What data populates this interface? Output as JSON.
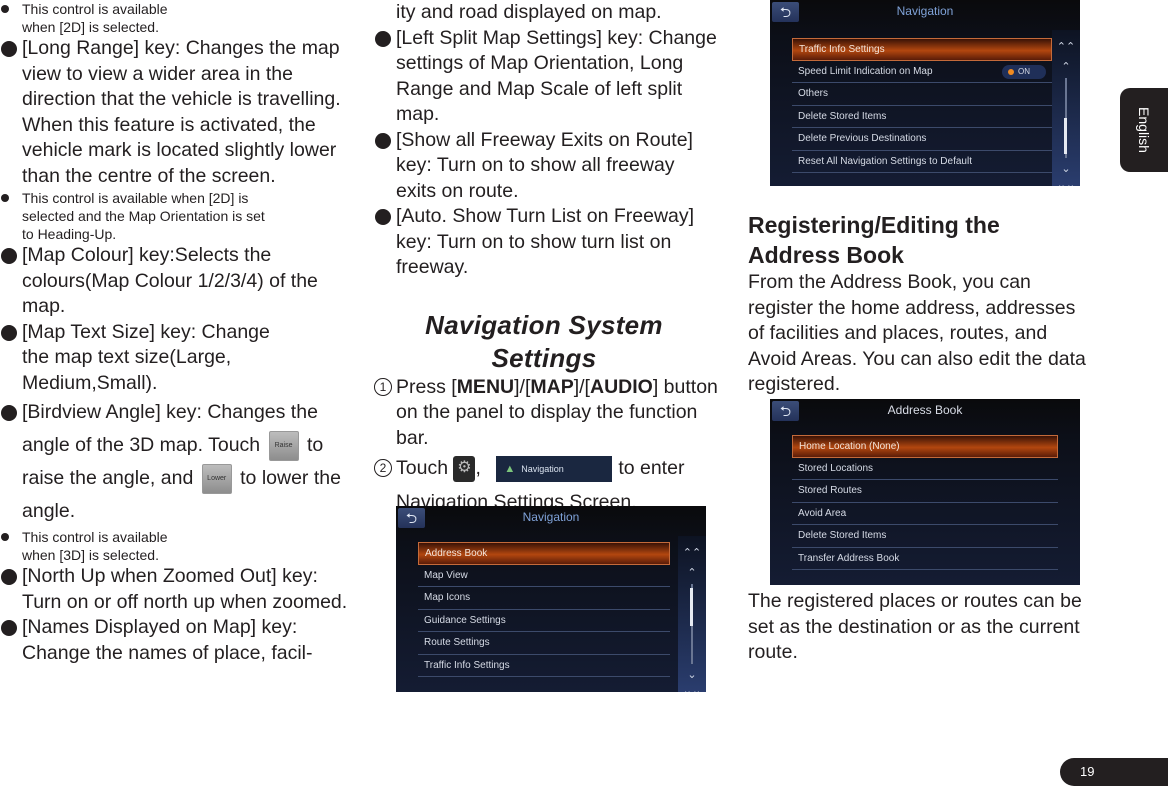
{
  "column1": {
    "note_2d": "This control is available when [2D] is selected.",
    "long_range": "[Long Range] key: Changes the map view to view a wider area in the direction that the vehicle is travelling. When this feature is activated, the vehicle mark is located slightly lower than the centre of the screen.",
    "note_heading_up": "This control is available when [2D] is selected and the Map Orientation is set to Heading-Up.",
    "map_colour": "[Map Colour] key:Selects the colours(Map Colour 1/2/3/4) of the map.",
    "map_text_size": "[Map Text Size] key: Change the map text size(Large, Medium,Small).",
    "birdview_a": "[Birdview Angle] key: Changes the angle of the 3D map. Touch",
    "raise_label": "Raise",
    "birdview_b": "to raise the angle, and",
    "lower_label": "Lower",
    "birdview_c": "to lower the angle.",
    "note_3d": "This control is available when [3D] is selected.",
    "north_up": "[North Up when Zoomed Out] key: Turn on or off north up when zoomed.",
    "names_displayed": "[Names Displayed on Map] key: Change  the names of place, facil-"
  },
  "column2": {
    "names_cont": "ity and road displayed on map.",
    "left_split": "[Left Split Map Settings] key: Change settings of Map Orientation, Long Range and Map Scale of left split map.",
    "freeway_exits": "[Show all Freeway Exits on Route] key: Turn on to show all freeway exits on route.",
    "turn_list": "[Auto. Show Turn List on Freeway] key: Turn on to show turn list on freeway.",
    "section_title": "Navigation System Settings",
    "step1_num": "1",
    "step1_a": "Press [",
    "step1_menu": "MENU",
    "step1_b": "]/[",
    "step1_map": "MAP",
    "step1_c": "]/[",
    "step1_audio": "AUDIO",
    "step1_d": "] button on the panel to display the function bar.",
    "step2_num": "2",
    "step2_a": "Touch",
    "step2_sep": ",",
    "nav_chip_label": "Navigation",
    "step2_b": "to enter Navigation Settings Screen.",
    "screen": {
      "title": "Navigation",
      "items": [
        "Address Book",
        "Map View",
        "Map Icons",
        "Guidance Settings",
        "Route Settings",
        "Traffic Info Settings"
      ],
      "selected_index": 0
    }
  },
  "column3": {
    "screen": {
      "title": "Navigation",
      "items": [
        "Traffic Info Settings",
        "Speed Limit Indication on Map",
        "Others",
        "Delete Stored Items",
        "Delete Previous Destinations",
        "Reset All Navigation Settings to Default"
      ],
      "selected_index": 0,
      "toggle_label": "ON"
    },
    "heading": "Registering/Editing the Address Book",
    "intro": "From the  Address Book, you can register the home address, addresses of facilities and places, routes, and Avoid Areas. You can also edit the data registered.",
    "address_screen": {
      "title": "Address Book",
      "items": [
        "Home Location (None)",
        "Stored Locations",
        "Stored Routes",
        "Avoid Area",
        "Delete Stored Items",
        "Transfer Address Book"
      ],
      "selected_index": 0
    },
    "outro": "The registered places or routes can be set as the destination or as the current route."
  },
  "side_tab": "English",
  "page_number": "19",
  "icons": {
    "back": "⮌",
    "double_up": "»",
    "up": "^",
    "down": "v",
    "gear": "⚙"
  }
}
